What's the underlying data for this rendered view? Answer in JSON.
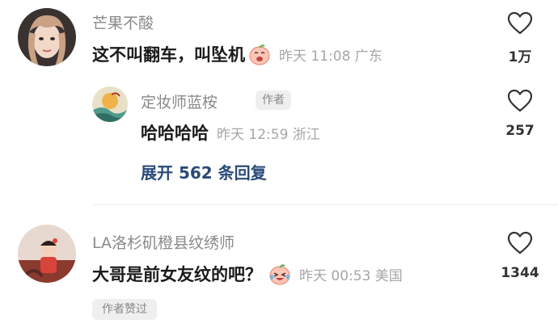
{
  "comments": [
    {
      "username": "芒果不酸",
      "text": "这不叫翻车，叫坠机",
      "emoji_icon": "peach-cry-laugh-emoji",
      "meta": "昨天 11:08 广东",
      "like_count": "1万",
      "reply": {
        "username": "定妆师蓝桉",
        "author_tag": "作者",
        "text": "哈哈哈哈",
        "meta": "昨天 12:59 浙江",
        "like_count": "257"
      },
      "expand_label": "展开 562 条回复"
    },
    {
      "username": "LA洛杉矶橙县纹绣师",
      "text": "大哥是前女友纹的吧？",
      "emoji_icon": "peach-laugh-tears-emoji",
      "meta": "昨天 00:53 美国",
      "like_count": "1344",
      "author_liked_tag": "作者赞过"
    }
  ],
  "colors": {
    "link_blue": "#2a4a78",
    "meta_gray": "#a6a6a6",
    "tag_bg": "#efefef"
  }
}
